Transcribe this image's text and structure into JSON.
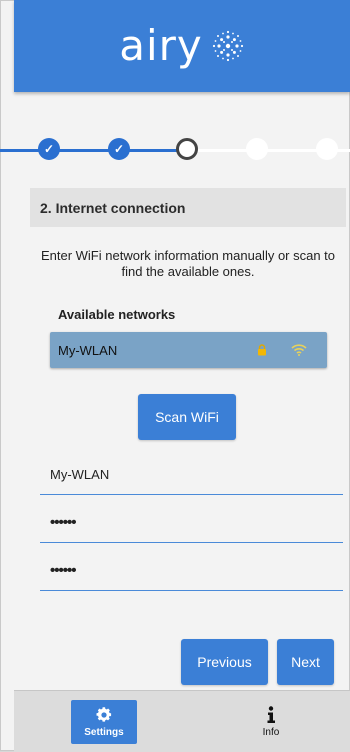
{
  "header": {
    "logo_text": "airy"
  },
  "stepper": {
    "steps": [
      {
        "state": "done"
      },
      {
        "state": "done"
      },
      {
        "state": "current"
      },
      {
        "state": "todo"
      },
      {
        "state": "todo"
      }
    ],
    "check_glyph": "✓"
  },
  "section": {
    "title": "2. Internet connection",
    "intro": "Enter WiFi network information manually or scan to find the available ones."
  },
  "networks": {
    "label": "Available networks",
    "items": [
      {
        "name": "My-WLAN",
        "secured": true,
        "signal_icon": "wifi-icon"
      }
    ]
  },
  "scan_button": {
    "label": "Scan WiFi"
  },
  "form": {
    "ssid_value": "My-WLAN",
    "password_value": "••••••",
    "password_confirm_value": "••••••"
  },
  "nav": {
    "previous_label": "Previous",
    "next_label": "Next"
  },
  "footer": {
    "tabs": [
      {
        "label": "Settings",
        "icon": "gear-icon",
        "active": true
      },
      {
        "label": "Info",
        "icon": "info-icon",
        "active": false
      }
    ]
  },
  "colors": {
    "accent": "#3b7fd6",
    "network_row": "#7aa3c6",
    "step_done": "#2a6fd0",
    "step_todo": "#ffffff"
  }
}
